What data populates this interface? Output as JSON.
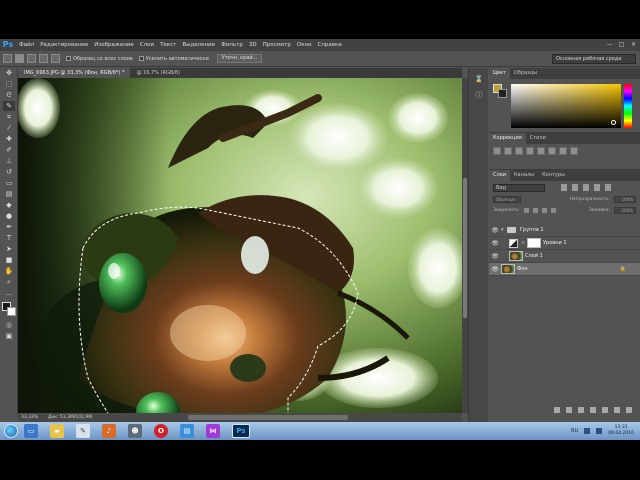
{
  "menubar": {
    "logo": "Ps",
    "items": [
      "Файл",
      "Редактирование",
      "Изображение",
      "Слои",
      "Текст",
      "Выделение",
      "Фильтр",
      "3D",
      "Просмотр",
      "Окно",
      "Справка"
    ],
    "minimize": "—",
    "maximize": "□",
    "close": "✕"
  },
  "options": {
    "sample_all": "Образец со всех слоев",
    "enhance_edges": "Усилить автоматически",
    "refine_edge": "Уточн. край...",
    "workspace": "Основная рабочая среда"
  },
  "tabs": {
    "active": "IMG_6963.JPG @ 33,3% (Фон, RGB/8*) *",
    "second": "@ 16,7% (RGB/8)"
  },
  "status": {
    "zoom": "33,33%",
    "doc_size": "Док: 51,3M/102,9M"
  },
  "panels": {
    "color_tabs": [
      "Цвет",
      "Образцы"
    ],
    "adjust_tabs": [
      "Коррекция",
      "Стили"
    ],
    "layers_tabs": [
      "Слои",
      "Каналы",
      "Контуры"
    ],
    "filter_kind": "Вид",
    "blend_mode": "Обычные",
    "opacity_label": "Непрозрачность:",
    "opacity_value": "100%",
    "lock_label": "Закрепить:",
    "fill_label": "Заливка:",
    "fill_value": "100%",
    "layers": [
      {
        "name": "Группа 1",
        "type": "group"
      },
      {
        "name": "Уровни 1",
        "type": "adjustment"
      },
      {
        "name": "Слой 1",
        "type": "photo"
      },
      {
        "name": "Фон",
        "type": "background"
      }
    ]
  },
  "taskbar": {
    "ps_label": "Ps",
    "lang": "RU",
    "time": "13:31",
    "date": "09.04.2016"
  },
  "colors": {
    "ps_blue": "#31a8ff",
    "ui_gray": "#535353",
    "selection_fg": "#c0a030"
  }
}
